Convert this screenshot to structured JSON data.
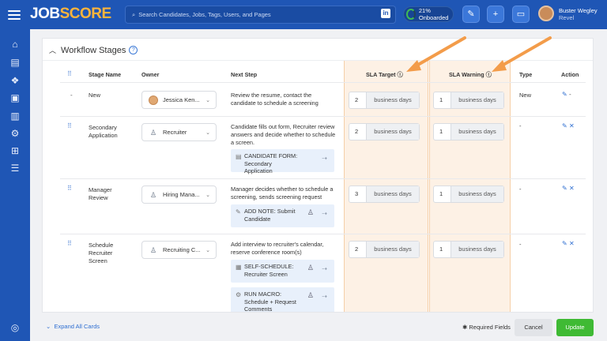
{
  "header": {
    "logo_left": "JOB",
    "logo_right": "SCORE",
    "search_placeholder": "Search Candidates, Jobs, Tags, Users, and Pages",
    "linkedin": "in",
    "onboarded": "21% Onboarded",
    "user_name": "Buster Wegley",
    "user_org": "Revel"
  },
  "sidebar": {
    "icons": [
      "home-icon",
      "clipboard-icon",
      "paw-icon",
      "briefcase-icon",
      "analytics-icon",
      "settings-icon",
      "apps-icon",
      "document-list-icon",
      "support-icon"
    ]
  },
  "section": {
    "title": "Workflow Stages",
    "help": "?"
  },
  "columns": {
    "stage_name": "Stage Name",
    "owner": "Owner",
    "next_step": "Next Step",
    "sla_target": "SLA Target",
    "sla_warning": "SLA Warning",
    "type": "Type",
    "action": "Action"
  },
  "rows": [
    {
      "stage": "New",
      "owner": "Jessica Ken...",
      "next_step": "Review the resume, contact the candidate to schedule a screening",
      "sla_target": "2",
      "sla_target_unit": "business days",
      "sla_warning": "1",
      "sla_warning_unit": "business days",
      "type": "New"
    },
    {
      "stage": "Secondary Application",
      "owner": "Recruiter",
      "next_step": "Candidate fills out form, Recruiter review answers and decide whether to schedule a screen.",
      "action_label": "CANDIDATE FORM: Secondary Application",
      "sla_target": "2",
      "sla_target_unit": "business days",
      "sla_warning": "1",
      "sla_warning_unit": "business days",
      "type": "-"
    },
    {
      "stage": "Manager Review",
      "owner": "Hiring Mana...",
      "next_step": "Manager decides whether to schedule a screening, sends screening request",
      "action_label": "ADD NOTE: Submit Candidate",
      "sla_target": "3",
      "sla_target_unit": "business days",
      "sla_warning": "1",
      "sla_warning_unit": "business days",
      "type": "-"
    },
    {
      "stage": "Schedule Recruiter Screen",
      "owner": "Recruiting C...",
      "next_step": "Add interview to recruiter's calendar, reserve conference room(s)",
      "action_label": "SELF-SCHEDULE: Recruiter Screen",
      "action_label_2": "RUN MACRO: Schedule + Request Comments",
      "sla_target": "2",
      "sla_target_unit": "business days",
      "sla_warning": "1",
      "sla_warning_unit": "business days",
      "type": "-"
    }
  ],
  "footer": {
    "expand": "Expand All Cards",
    "required": "Required Fields",
    "cancel": "Cancel",
    "update": "Update"
  },
  "colors": {
    "brand": "#1f56b5",
    "accent_orange": "#f39c4a",
    "update_green": "#3fba34"
  }
}
